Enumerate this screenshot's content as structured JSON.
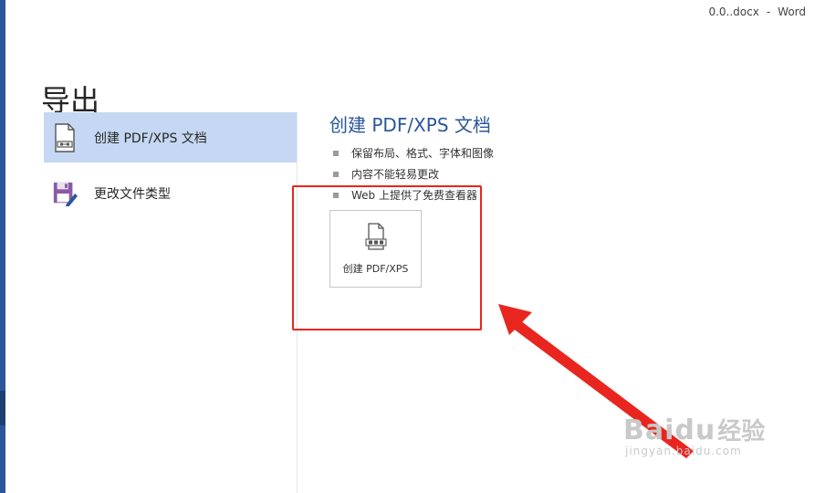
{
  "window": {
    "file_name": "0.0..docx",
    "separator": "-",
    "app_name": "Word"
  },
  "page": {
    "title": "导出"
  },
  "nav": {
    "items": [
      {
        "label": "创建 PDF/XPS 文档",
        "icon": "pdf-document-icon",
        "selected": true
      },
      {
        "label": "更改文件类型",
        "icon": "save-as-icon",
        "selected": false
      }
    ]
  },
  "detail": {
    "title": "创建 PDF/XPS 文档",
    "bullets": [
      "保留布局、格式、字体和图像",
      "内容不能轻易更改",
      "Web 上提供了免费查看器"
    ],
    "button_label": "创建 PDF/XPS",
    "button_icon": "pdf-document-icon"
  },
  "annotation": {
    "box_color": "#e8261f",
    "arrow_color": "#e8261f"
  },
  "watermark": {
    "brand": "Baidu",
    "brand_cn": "经验",
    "url": "jingyan.baidu.com"
  },
  "colors": {
    "accent": "#2b579a",
    "selected_bg": "#c5d7f2"
  }
}
